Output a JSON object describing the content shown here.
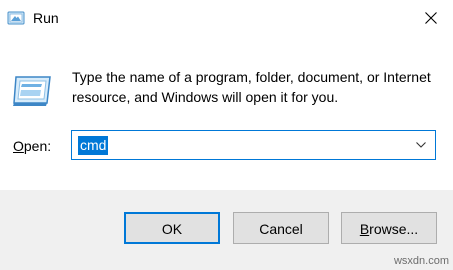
{
  "window": {
    "title": "Run",
    "icon": "run-dialog-icon",
    "close_icon": "close-icon"
  },
  "content": {
    "description": "Type the name of a program, folder, document, or Internet resource, and Windows will open it for you.",
    "open_label_mnemonic": "O",
    "open_label_rest": "pen:",
    "input_value": "cmd",
    "dropdown_icon": "chevron-down-icon"
  },
  "buttons": {
    "ok": "OK",
    "cancel": "Cancel",
    "browse_mnemonic": "B",
    "browse_rest": "rowse..."
  },
  "watermark": "wsxdn.com",
  "colors": {
    "accent": "#0078d7",
    "footer_bg": "#f0f0f0",
    "button_bg": "#e1e1e1"
  }
}
